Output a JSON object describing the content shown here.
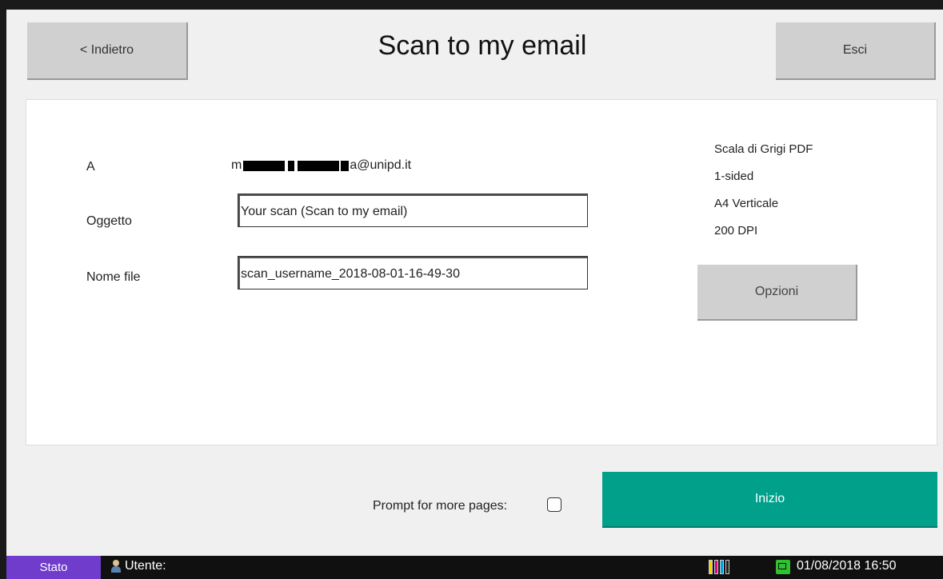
{
  "header": {
    "back_label": "< Indietro",
    "title": "Scan to my email",
    "exit_label": "Esci"
  },
  "form": {
    "to_label": "A",
    "to_value_prefix": "m",
    "to_value_suffix": "a@unipd.it",
    "subject_label": "Oggetto",
    "subject_value": "Your scan (Scan to my email)",
    "filename_label": "Nome file",
    "filename_value": "scan_username_2018-08-01-16-49-30"
  },
  "settings": {
    "color_mode": "Scala di Grigi PDF",
    "sides": "1-sided",
    "paper": "A4 Verticale",
    "resolution": "200 DPI",
    "options_label": "Opzioni"
  },
  "footer": {
    "prompt_label": "Prompt for more pages:",
    "prompt_checked": false,
    "start_label": "Inizio"
  },
  "statusbar": {
    "stato_label": "Stato",
    "user_label": "Utente:",
    "datetime": "01/08/2018  16:50",
    "toner_colors": [
      "#f5d000",
      "#e0007a",
      "#00a0e0",
      "#202020"
    ],
    "stato_color": "#6f3ccc",
    "accent_color": "#00a08a"
  }
}
